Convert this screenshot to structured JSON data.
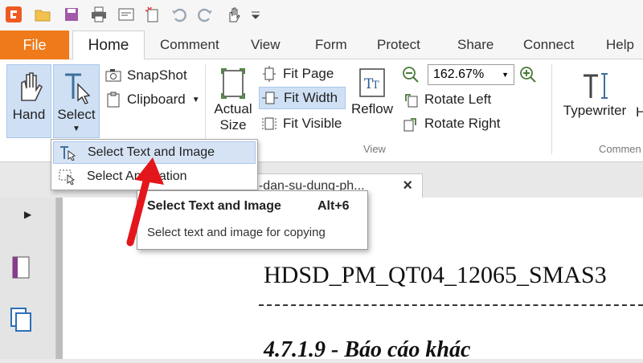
{
  "quick_access": {
    "icons": [
      "app-logo-icon",
      "open-folder-icon",
      "save-icon",
      "print-icon",
      "email-icon",
      "new-icon",
      "undo-icon",
      "redo-icon",
      "hand-tool-icon",
      "customize-icon"
    ]
  },
  "tabs": {
    "file": "File",
    "home": "Home",
    "items": [
      "Comment",
      "View",
      "Form",
      "Protect",
      "Share",
      "Connect",
      "Help"
    ]
  },
  "ribbon": {
    "hand": "Hand",
    "select": "Select",
    "snapshot": "SnapShot",
    "clipboard": "Clipboard",
    "actual_size_1": "Actual",
    "actual_size_2": "Size",
    "fit_page": "Fit Page",
    "fit_width": "Fit Width",
    "fit_visible": "Fit Visible",
    "reflow": "Reflow",
    "zoom_value": "162.67%",
    "rotate_left": "Rotate Left",
    "rotate_right": "Rotate Right",
    "typewriter": "Typewriter",
    "cut_letter": "H",
    "group_view": "View",
    "group_comment": "Commen"
  },
  "dropdown": {
    "item1": "Select Text and Image",
    "item2": "Select Annotation"
  },
  "tooltip": {
    "title": "Select Text and Image",
    "shortcut": "Alt+6",
    "description": "Select text and image for copying"
  },
  "document": {
    "tab_name": "g-dan-su-dung-ph...",
    "tab_close": "×",
    "heading": "HDSD_PM_QT04_12065_SMAS3",
    "section": "4.7.1.9 - Báo cáo khác"
  },
  "colors": {
    "file_tab": "#ef7a1a",
    "selected": "#cfe0f5",
    "arrow": "#e3161b"
  }
}
